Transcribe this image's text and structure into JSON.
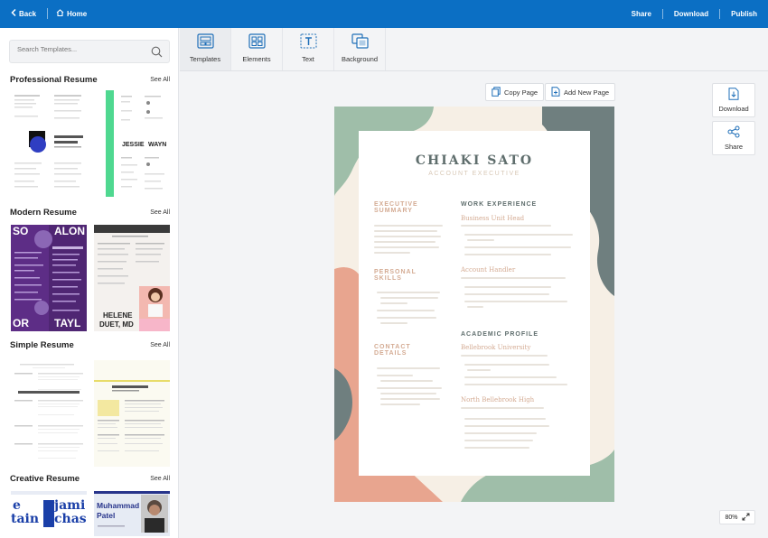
{
  "topbar": {
    "back_label": "Back",
    "home_label": "Home",
    "share_label": "Share",
    "download_label": "Download",
    "publish_label": "Publish"
  },
  "sidebar": {
    "search_placeholder": "Search Templates...",
    "see_all": "See All",
    "sections": [
      {
        "title": "Professional Resume"
      },
      {
        "title": "Modern Resume"
      },
      {
        "title": "Simple Resume"
      },
      {
        "title": "Creative Resume"
      }
    ],
    "thumb_text": {
      "jessie": "JESSIE",
      "wayne": "WAYN",
      "so": "SO",
      "alon": "ALON",
      "or": "OR",
      "tayl": "TAYL",
      "helene": "HELENE",
      "duet": "DUET, MD",
      "e": "e",
      "tain": "tain",
      "jami": "jami",
      "chas": "chas",
      "muhammad": "Muhammad",
      "patel": "Patel"
    }
  },
  "tools": [
    {
      "label": "Templates",
      "icon": "templates-icon"
    },
    {
      "label": "Elements",
      "icon": "elements-icon"
    },
    {
      "label": "Text",
      "icon": "text-icon"
    },
    {
      "label": "Background",
      "icon": "background-icon"
    }
  ],
  "canvas": {
    "copy_page": "Copy Page",
    "add_new_page": "Add New Page",
    "download": "Download",
    "share": "Share",
    "zoom": "80%"
  },
  "resume": {
    "name": "CHIAKI SATO",
    "role": "ACCOUNT EXECUTIVE",
    "summary_heading_1": "EXECUTIVE",
    "summary_heading_2": "SUMMARY",
    "skills_heading_1": "PERSONAL",
    "skills_heading_2": "SKILLS",
    "contact_heading_1": "CONTACT",
    "contact_heading_2": "DETAILS",
    "work_heading": "WORK EXPERIENCE",
    "academic_heading": "ACADEMIC PROFILE",
    "job_1_title": "Business Unit Head",
    "job_2_title": "Account Handler",
    "school_1": "Bellebrook University",
    "school_2": "North Bellebrook High"
  },
  "colors": {
    "topbar": "#0b6fc4",
    "sage": "#9fbea9",
    "slate": "#6f7f7f",
    "peach": "#e8a58f",
    "cream": "#f6efe5"
  }
}
